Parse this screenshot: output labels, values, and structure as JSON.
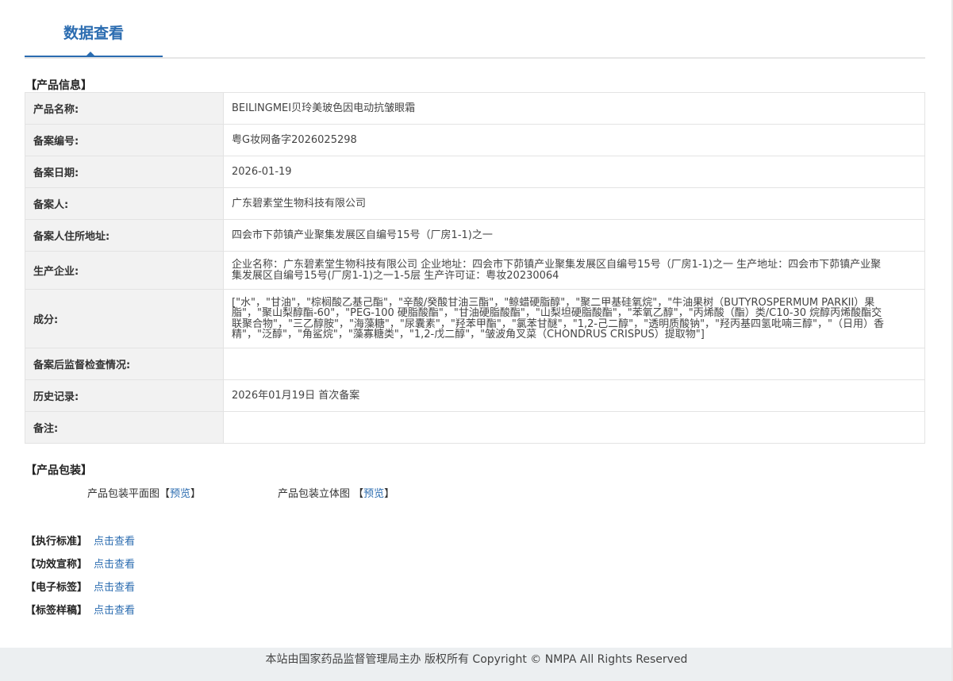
{
  "tab": {
    "label": "数据查看"
  },
  "product_info": {
    "heading": "【产品信息】",
    "rows": [
      {
        "label": "产品名称:",
        "value": "BEILINGMEI贝玲美玻色因电动抗皱眼霜"
      },
      {
        "label": "备案编号:",
        "value": "粤G妆网备字2026025298"
      },
      {
        "label": "备案日期:",
        "value": "2026-01-19"
      },
      {
        "label": "备案人:",
        "value": "广东碧素堂生物科技有限公司"
      },
      {
        "label": "备案人住所地址:",
        "value": "四会市下茆镇产业聚集发展区自编号15号（厂房1-1)之一"
      },
      {
        "label": "生产企业:",
        "value": "企业名称：广东碧素堂生物科技有限公司 企业地址：四会市下茆镇产业聚集发展区自编号15号（厂房1-1)之一 生产地址：四会市下茆镇产业聚集发展区自编号15号(厂房1-1)之一1-5层 生产许可证：粤妆20230064"
      },
      {
        "label": "成分:",
        "value": "[\"水\"，\"甘油\"，\"棕榈酸乙基己酯\"，\"辛酸/癸酸甘油三酯\"，\"鲸蜡硬脂醇\"，\"聚二甲基硅氧烷\"，\"牛油果树（BUTYROSPERMUM PARKII）果脂\"，\"聚山梨醇酯-60\"，\"PEG-100 硬脂酸酯\"，\"甘油硬脂酸酯\"，\"山梨坦硬脂酸酯\"，\"苯氧乙醇\"，\"丙烯酸（酯）类/C10-30 烷醇丙烯酸酯交联聚合物\"，\"三乙醇胺\"，\"海藻糖\"，\"尿囊素\"，\"羟苯甲酯\"，\"氯苯甘醚\"，\"1,2-己二醇\"，\"透明质酸钠\"，\"羟丙基四氢吡喃三醇\"，\"（日用）香精\"，\"泛醇\"，\"角鲨烷\"，\"藻寡糖类\"，\"1,2-戊二醇\"，\"皱波角叉菜（CHONDRUS CRISPUS）提取物\"]"
      },
      {
        "label": "备案后监督检查情况:",
        "value": ""
      },
      {
        "label": "历史记录:",
        "value": "2026年01月19日 首次备案"
      },
      {
        "label": "备注:",
        "value": ""
      }
    ]
  },
  "packaging": {
    "heading": "【产品包装】",
    "flat_label": "产品包装平面图",
    "flat_link": "预览",
    "solid_label": "产品包装立体图",
    "solid_link": "预览"
  },
  "standards": [
    {
      "label": "【执行标准】",
      "link": "点击查看"
    },
    {
      "label": "【功效宣称】",
      "link": "点击查看"
    },
    {
      "label": "【电子标签】",
      "link": "点击查看"
    },
    {
      "label": "【标签样稿】",
      "link": "点击查看"
    }
  ],
  "footer": {
    "text": "本站由国家药品监督管理局主办 版权所有 Copyright © NMPA All Rights Reserved"
  }
}
